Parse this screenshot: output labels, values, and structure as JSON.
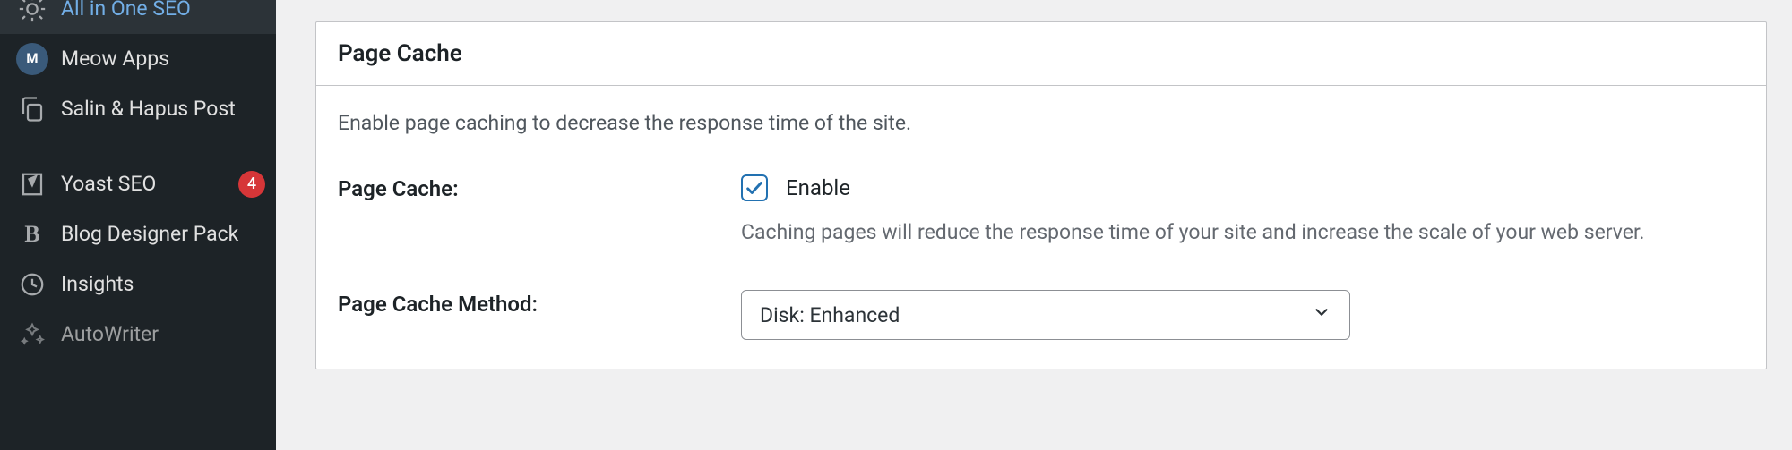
{
  "sidebar": {
    "items": [
      {
        "label": "All in One SEO",
        "icon": "aioseo"
      },
      {
        "label": "Meow Apps",
        "icon": "meow"
      },
      {
        "label": "Salin & Hapus Post",
        "icon": "copydelete"
      },
      {
        "label": "Yoast SEO",
        "icon": "yoast",
        "badge": "4"
      },
      {
        "label": "Blog Designer Pack",
        "icon": "bdp"
      },
      {
        "label": "Insights",
        "icon": "insights"
      },
      {
        "label": "AutoWriter",
        "icon": "autowriter"
      }
    ]
  },
  "card": {
    "title": "Page Cache",
    "description": "Enable page caching to decrease the response time of the site.",
    "fields": {
      "page_cache": {
        "label": "Page Cache:",
        "checkbox_label": "Enable",
        "help": "Caching pages will reduce the response time of your site and increase the scale of your web server."
      },
      "method": {
        "label": "Page Cache Method:",
        "selected": "Disk: Enhanced"
      }
    }
  }
}
